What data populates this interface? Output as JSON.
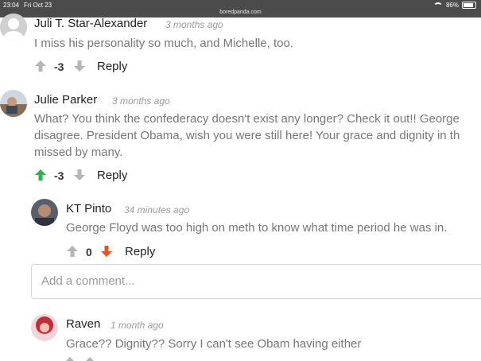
{
  "status": {
    "time": "23:04",
    "date": "Fri Oct 23",
    "url": "boredpanda.com",
    "battery": "86%",
    "battery_fraction": 0.86
  },
  "comments": [
    {
      "author": "Juli T. Star-Alexander",
      "time": "3 months ago",
      "lines": [
        "I miss his personality so much, and Michelle, too."
      ],
      "score": "-3",
      "reply_label": "Reply"
    },
    {
      "author": "Julie Parker",
      "time": "3 months ago",
      "lines": [
        "What? You think the confederacy doesn't exist any longer? Check it out!! George",
        "disagree. President Obama, wish you were still here! Your grace and dignity in th",
        "missed by many."
      ],
      "score": "-3",
      "reply_label": "Reply"
    },
    {
      "author": "KT Pinto",
      "time": "34 minutes ago",
      "lines": [
        "George Floyd was too high on meth to know what time period he was in."
      ],
      "score": "0",
      "reply_label": "Reply"
    },
    {
      "author": "Raven",
      "time": "1 month ago",
      "lines": [
        "Grace?? Dignity?? Sorry I can't see Obam having either"
      ]
    }
  ],
  "comment_input": {
    "placeholder": "Add a comment..."
  },
  "colors": {
    "upvote_active": "#2eb24b",
    "downvote_active": "#e8531e",
    "vote_inactive": "#b5b5b5"
  }
}
